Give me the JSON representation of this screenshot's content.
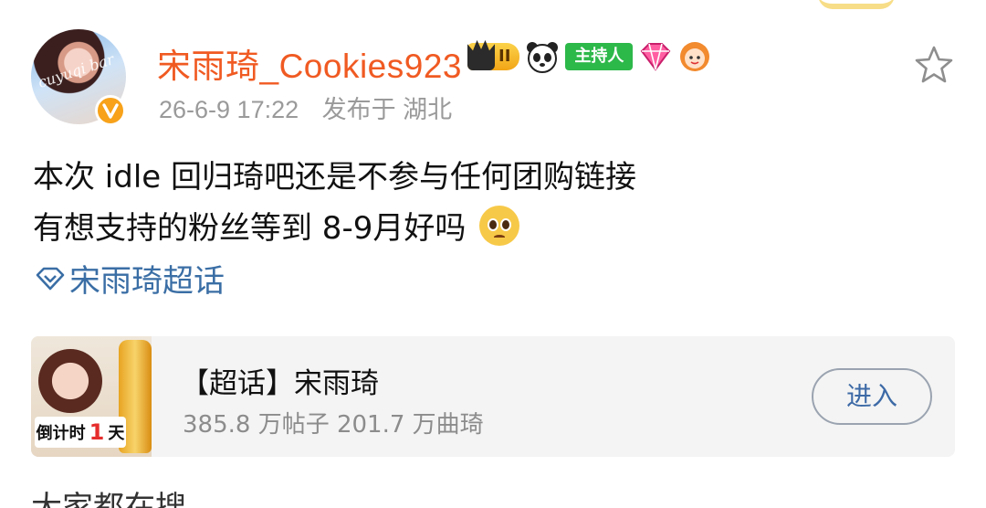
{
  "post": {
    "username": "宋雨琦_Cookies923",
    "avatar_text": "cuyuqi bar",
    "level_badge": "II",
    "host_badge": "主持人",
    "time": "26-6-9 17:22",
    "location": "发布于 湖北",
    "content_lines": [
      "本次 idle 回归琦吧还是不参与任何团购链接",
      "有想支持的粉丝等到 8-9月好吗"
    ],
    "topic_link": "宋雨琦超话",
    "icons": {
      "favorite": "star-outline-icon",
      "verified": "verified-v-icon",
      "topic": "super-topic-diamond-icon",
      "emoji": "pleading-face-emoji"
    }
  },
  "card": {
    "title": "【超话】宋雨琦",
    "stats": "385.8 万帖子 201.7 万曲琦",
    "button": "进入",
    "thumb_countdown_prefix": "倒计时",
    "thumb_countdown_num": "1",
    "thumb_countdown_unit": "天"
  },
  "footer": {
    "partial_text": "大家都在搜"
  },
  "colors": {
    "username": "#f05a22",
    "link": "#3a6ea5",
    "meta": "#9a9a9a",
    "host_badge": "#2db84a"
  }
}
